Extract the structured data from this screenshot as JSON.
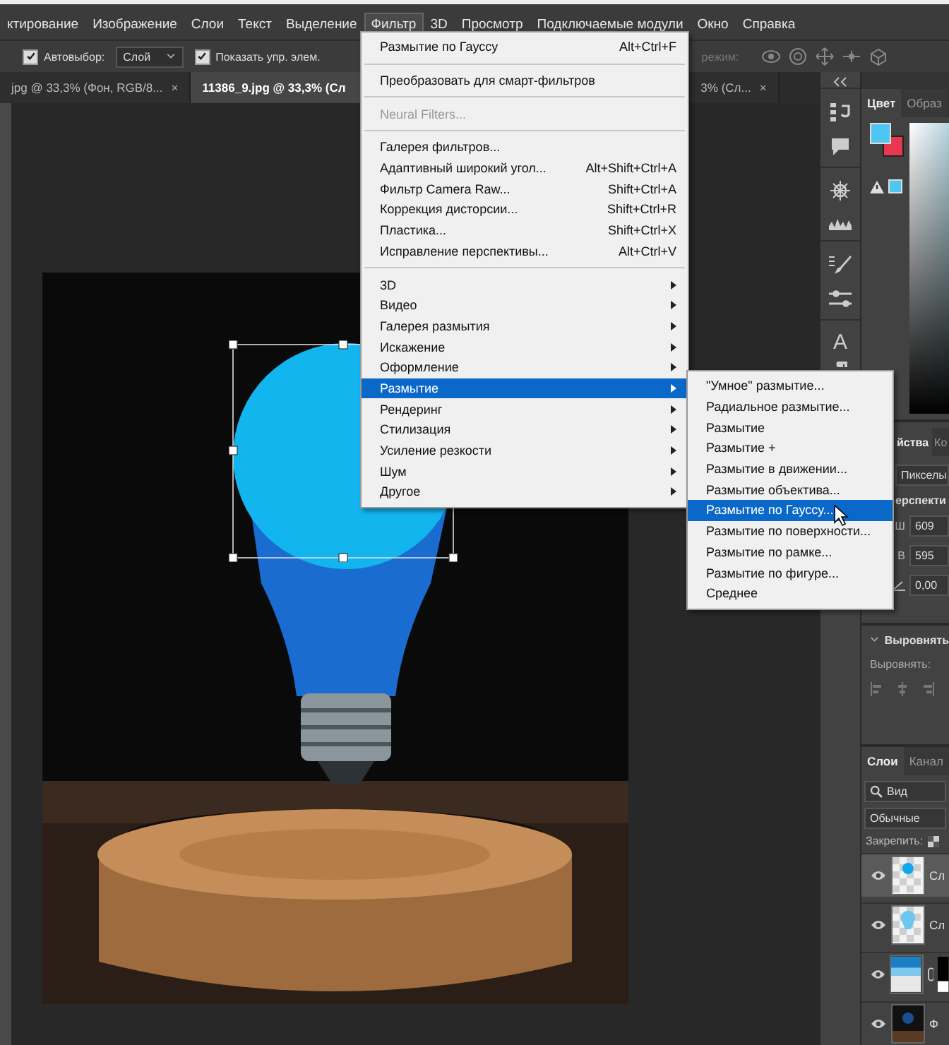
{
  "menu_bar": [
    {
      "label": "ктирование",
      "selected": false
    },
    {
      "label": "Изображение",
      "selected": false
    },
    {
      "label": "Слои",
      "selected": false
    },
    {
      "label": "Текст",
      "selected": false
    },
    {
      "label": "Выделение",
      "selected": false
    },
    {
      "label": "Фильтр",
      "selected": true
    },
    {
      "label": "3D",
      "selected": false
    },
    {
      "label": "Просмотр",
      "selected": false
    },
    {
      "label": "Подключаемые модули",
      "selected": false
    },
    {
      "label": "Окно",
      "selected": false
    },
    {
      "label": "Справка",
      "selected": false
    }
  ],
  "options_bar": {
    "auto_select": {
      "label": "Автовыбор:",
      "checked": true
    },
    "target": "Слой",
    "show_controls": {
      "label": "Показать упр. элем.",
      "checked": true
    },
    "mode_label": "режим:"
  },
  "doc_tabs": [
    {
      "title": "jpg @ 33,3% (Фон, RGB/8...",
      "close": "×",
      "selected": false
    },
    {
      "title": "11386_9.jpg @ 33,3% (Сл",
      "selected": true
    },
    {
      "title": "3% (Сл...",
      "close": "×",
      "selected": false
    }
  ],
  "filter_menu": {
    "sections": [
      [
        {
          "label": "Размытие по Гауссу",
          "shortcut": "Alt+Ctrl+F",
          "kind": "command",
          "disabled": false,
          "selected": false
        }
      ],
      [
        {
          "label": "Преобразовать для смарт-фильтров",
          "kind": "command",
          "disabled": false,
          "selected": false
        }
      ],
      [
        {
          "label": "Neural Filters...",
          "kind": "command",
          "disabled": true,
          "selected": false
        }
      ],
      [
        {
          "label": "Галерея фильтров...",
          "kind": "command",
          "disabled": false,
          "selected": false
        },
        {
          "label": "Адаптивный широкий угол...",
          "shortcut": "Alt+Shift+Ctrl+A",
          "kind": "command",
          "disabled": false,
          "selected": false
        },
        {
          "label": "Фильтр Camera Raw...",
          "shortcut": "Shift+Ctrl+A",
          "kind": "command",
          "disabled": false,
          "selected": false
        },
        {
          "label": "Коррекция дисторсии...",
          "shortcut": "Shift+Ctrl+R",
          "kind": "command",
          "disabled": false,
          "selected": false
        },
        {
          "label": "Пластика...",
          "shortcut": "Shift+Ctrl+X",
          "kind": "command",
          "disabled": false,
          "selected": false
        },
        {
          "label": "Исправление перспективы...",
          "shortcut": "Alt+Ctrl+V",
          "kind": "command",
          "disabled": false,
          "selected": false
        }
      ],
      [
        {
          "label": "3D",
          "kind": "submenu",
          "disabled": false,
          "selected": false
        },
        {
          "label": "Видео",
          "kind": "submenu",
          "disabled": false,
          "selected": false
        },
        {
          "label": "Галерея размытия",
          "kind": "submenu",
          "disabled": false,
          "selected": false
        },
        {
          "label": "Искажение",
          "kind": "submenu",
          "disabled": false,
          "selected": false
        },
        {
          "label": "Оформление",
          "kind": "submenu",
          "disabled": false,
          "selected": false
        },
        {
          "label": "Размытие",
          "kind": "submenu",
          "disabled": false,
          "selected": true
        },
        {
          "label": "Рендеринг",
          "kind": "submenu",
          "disabled": false,
          "selected": false
        },
        {
          "label": "Стилизация",
          "kind": "submenu",
          "disabled": false,
          "selected": false
        },
        {
          "label": "Усиление резкости",
          "kind": "submenu",
          "disabled": false,
          "selected": false
        },
        {
          "label": "Шум",
          "kind": "submenu",
          "disabled": false,
          "selected": false
        },
        {
          "label": "Другое",
          "kind": "submenu",
          "disabled": false,
          "selected": false
        }
      ]
    ]
  },
  "blur_submenu": [
    {
      "label": "\"Умное\" размытие...",
      "selected": false
    },
    {
      "label": "Радиальное размытие...",
      "selected": false
    },
    {
      "label": "Размытие",
      "selected": false
    },
    {
      "label": "Размытие +",
      "selected": false
    },
    {
      "label": "Размытие в движении...",
      "selected": false
    },
    {
      "label": "Размытие объектива...",
      "selected": false
    },
    {
      "label": "Размытие по Гауссу...",
      "selected": true
    },
    {
      "label": "Размытие по поверхности...",
      "selected": false
    },
    {
      "label": "Размытие по рамке...",
      "selected": false
    },
    {
      "label": "Размытие по фигуре...",
      "selected": false
    },
    {
      "label": "Среднее",
      "selected": false
    }
  ],
  "tool_strip": {
    "type_glyph": "A"
  },
  "color_panel": {
    "tabs": [
      {
        "label": "Цвет",
        "selected": true
      },
      {
        "label": "Образ",
        "selected": false
      }
    ]
  },
  "properties_panel": {
    "tabs": [
      {
        "label": "йства",
        "selected": true
      },
      {
        "label": "Ко",
        "selected": false
      }
    ],
    "kind": "Пикселы",
    "section": "ерспекти",
    "fields": [
      {
        "label": "Ш",
        "value": "609"
      },
      {
        "label": "В",
        "value": "595"
      }
    ],
    "angle": "0,00"
  },
  "align_panel": {
    "title": "Выровнять",
    "expanded": true,
    "label": "Выровнять:"
  },
  "layers_panel": {
    "tabs": [
      {
        "label": "Слои",
        "selected": true
      },
      {
        "label": "Канал",
        "selected": false
      }
    ],
    "filter": "Вид",
    "blend_mode": "Обычные",
    "lock_label": "Закрепить:",
    "layers": [
      {
        "name": "Сл",
        "kind": "dot",
        "selected": true,
        "visible": true
      },
      {
        "name": "Сл",
        "kind": "bulb",
        "selected": false,
        "visible": true
      },
      {
        "kind": "photo-mask",
        "selected": false,
        "visible": true
      },
      {
        "name": "Ф",
        "kind": "dark",
        "selected": false,
        "visible": true
      }
    ]
  }
}
